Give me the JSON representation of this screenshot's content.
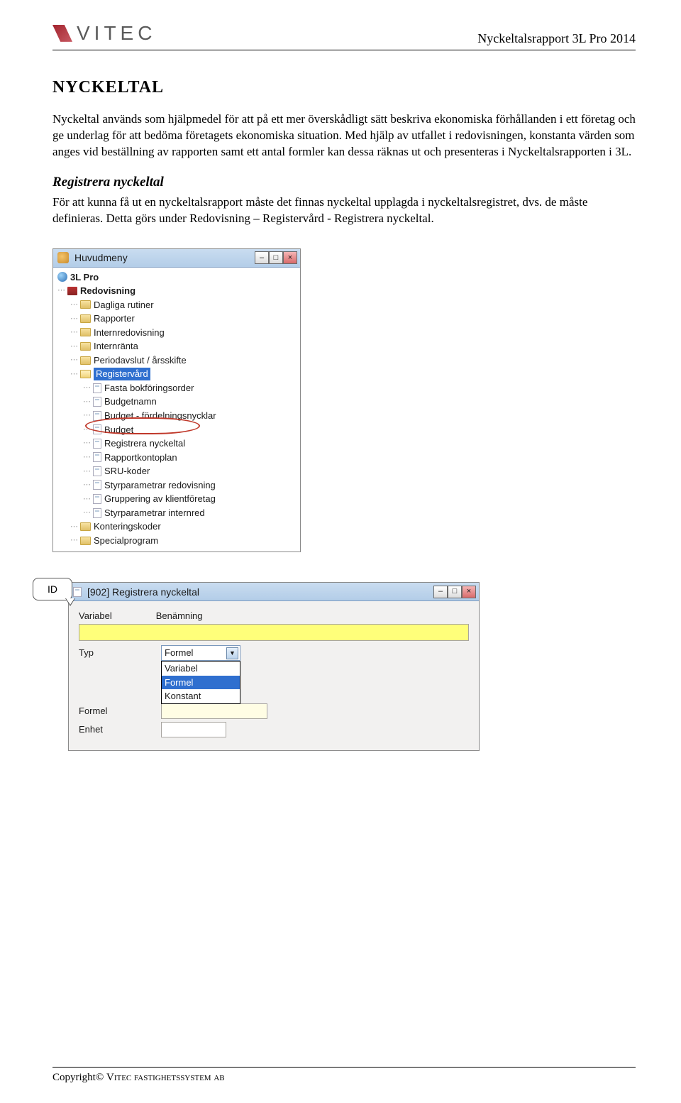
{
  "header": {
    "logo_text": "VITEC",
    "doc_title": "Nyckeltalsrapport 3L Pro 2014"
  },
  "section": {
    "title": "NYCKELTAL",
    "para1": "Nyckeltal används som hjälpmedel för att på ett mer överskådligt sätt beskriva ekonomiska förhållanden i ett företag och ge underlag för att bedöma företagets ekonomiska situation. Med hjälp av utfallet i redovisningen, konstanta värden som anges vid beställning av rapporten samt ett antal formler kan dessa räknas ut och presenteras i Nyckeltalsrapporten i 3L.",
    "subheading": "Registrera nyckeltal",
    "para2": "För att kunna få ut en nyckeltalsrapport måste det finnas nyckeltal upplagda i nyckeltalsregistret, dvs. de måste definieras. Detta görs under Redovisning – Registervård - Registrera nyckeltal."
  },
  "menu_window": {
    "title": "Huvudmeny",
    "root": "3L Pro",
    "section": "Redovisning",
    "folders": [
      "Dagliga rutiner",
      "Rapporter",
      "Internredovisning",
      "Internränta",
      "Periodavslut / årsskifte"
    ],
    "open_folder": "Registervård",
    "docs": [
      "Fasta bokföringsorder",
      "Budgetnamn",
      "Budget - fördelningsnycklar",
      "Budget",
      "Registrera nyckeltal",
      "Rapportkontoplan",
      "SRU-koder",
      "Styrparametrar redovisning",
      "Gruppering av klientföretag",
      "Styrparametrar internred"
    ],
    "tail_folders": [
      "Konteringskoder",
      "Specialprogram"
    ],
    "winbtns": {
      "min": "–",
      "max": "□",
      "close": "×"
    }
  },
  "form_window": {
    "title": "[902]  Registrera nyckeltal",
    "callout": "ID",
    "col1": "Variabel",
    "col2": "Benämning",
    "row_typ": "Typ",
    "row_formel": "Formel",
    "row_enhet": "Enhet",
    "select_value": "Formel",
    "options": [
      "Variabel",
      "Formel",
      "Konstant"
    ],
    "winbtns": {
      "min": "–",
      "max": "□",
      "close": "×"
    }
  },
  "footer": {
    "text_prefix": "Copyright© ",
    "text_smallcaps": "Vitec fastighetssystem ab"
  }
}
